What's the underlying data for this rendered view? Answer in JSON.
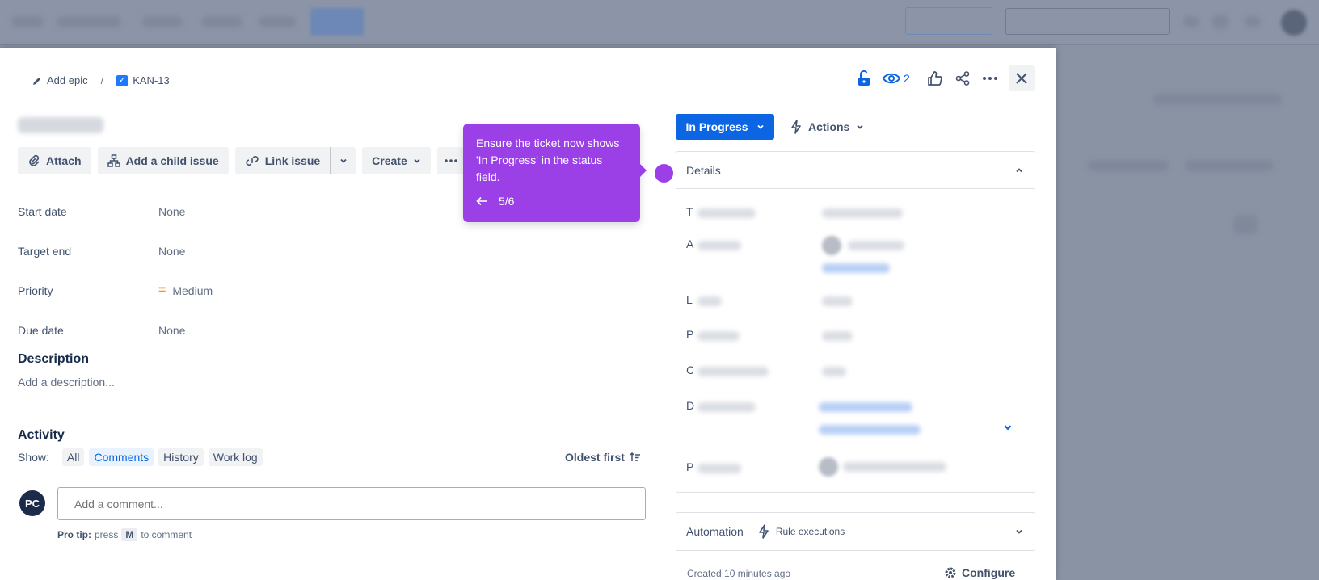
{
  "breadcrumb": {
    "add_epic": "Add epic",
    "separator": "/",
    "issue_key": "KAN-13"
  },
  "toolbar": {
    "attach": "Attach",
    "add_child": "Add a child issue",
    "link_issue": "Link issue",
    "create": "Create"
  },
  "fields": [
    {
      "label": "Start date",
      "value": "None"
    },
    {
      "label": "Target end",
      "value": "None"
    },
    {
      "label": "Priority",
      "value": "Medium"
    },
    {
      "label": "Due date",
      "value": "None"
    }
  ],
  "description": {
    "heading": "Description",
    "placeholder": "Add a description..."
  },
  "activity": {
    "heading": "Activity",
    "show_label": "Show:",
    "filters": [
      "All",
      "Comments",
      "History",
      "Work log"
    ],
    "sort": "Oldest first",
    "avatar_initials": "PC",
    "comment_placeholder": "Add a comment...",
    "protip_prefix": "Pro tip:",
    "protip_press": "press",
    "protip_key": "M",
    "protip_suffix": "to comment"
  },
  "header": {
    "watch_count": "2"
  },
  "status": {
    "label": "In Progress"
  },
  "actions": {
    "label": "Actions"
  },
  "details": {
    "heading": "Details",
    "row_initials": [
      "T",
      "A",
      "L",
      "P",
      "C",
      "D",
      "P"
    ]
  },
  "automation": {
    "label": "Automation",
    "rule": "Rule executions"
  },
  "footer": {
    "created": "Created 10 minutes ago",
    "configure": "Configure"
  },
  "tooltip": {
    "message": "Ensure the ticket now shows 'In Progress' in the status field.",
    "step": "5/6"
  },
  "colors": {
    "accent": "#0c66e4",
    "tooltip": "#9b3fe6",
    "priority": "#f79233"
  }
}
